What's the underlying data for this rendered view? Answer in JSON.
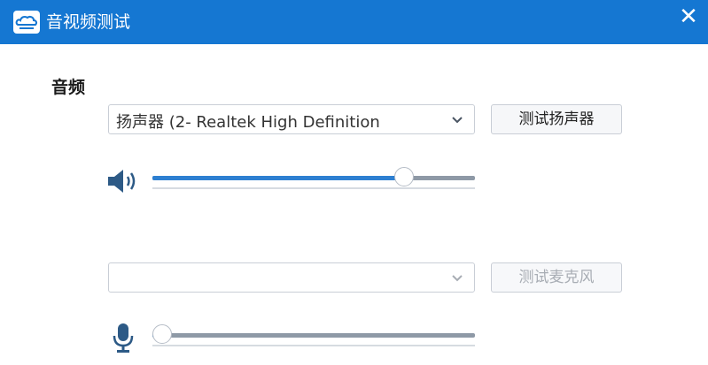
{
  "window": {
    "title": "音视频测试",
    "close_glyph": "✕",
    "logo_icon": "cloud-logo-icon"
  },
  "audio": {
    "section_title": "音频",
    "speaker": {
      "device_value": "扬声器 (2- Realtek High Definition",
      "test_button_label": "测试扬声器",
      "volume_percent": 78,
      "icon": "speaker-icon"
    },
    "microphone": {
      "device_value": "",
      "test_button_label": "测试麦克风",
      "test_button_enabled": false,
      "volume_percent": 3,
      "icon": "microphone-icon"
    }
  },
  "colors": {
    "titlebar": "#1577d2",
    "accent": "#2d7fd1",
    "track": "#8e99a6"
  }
}
